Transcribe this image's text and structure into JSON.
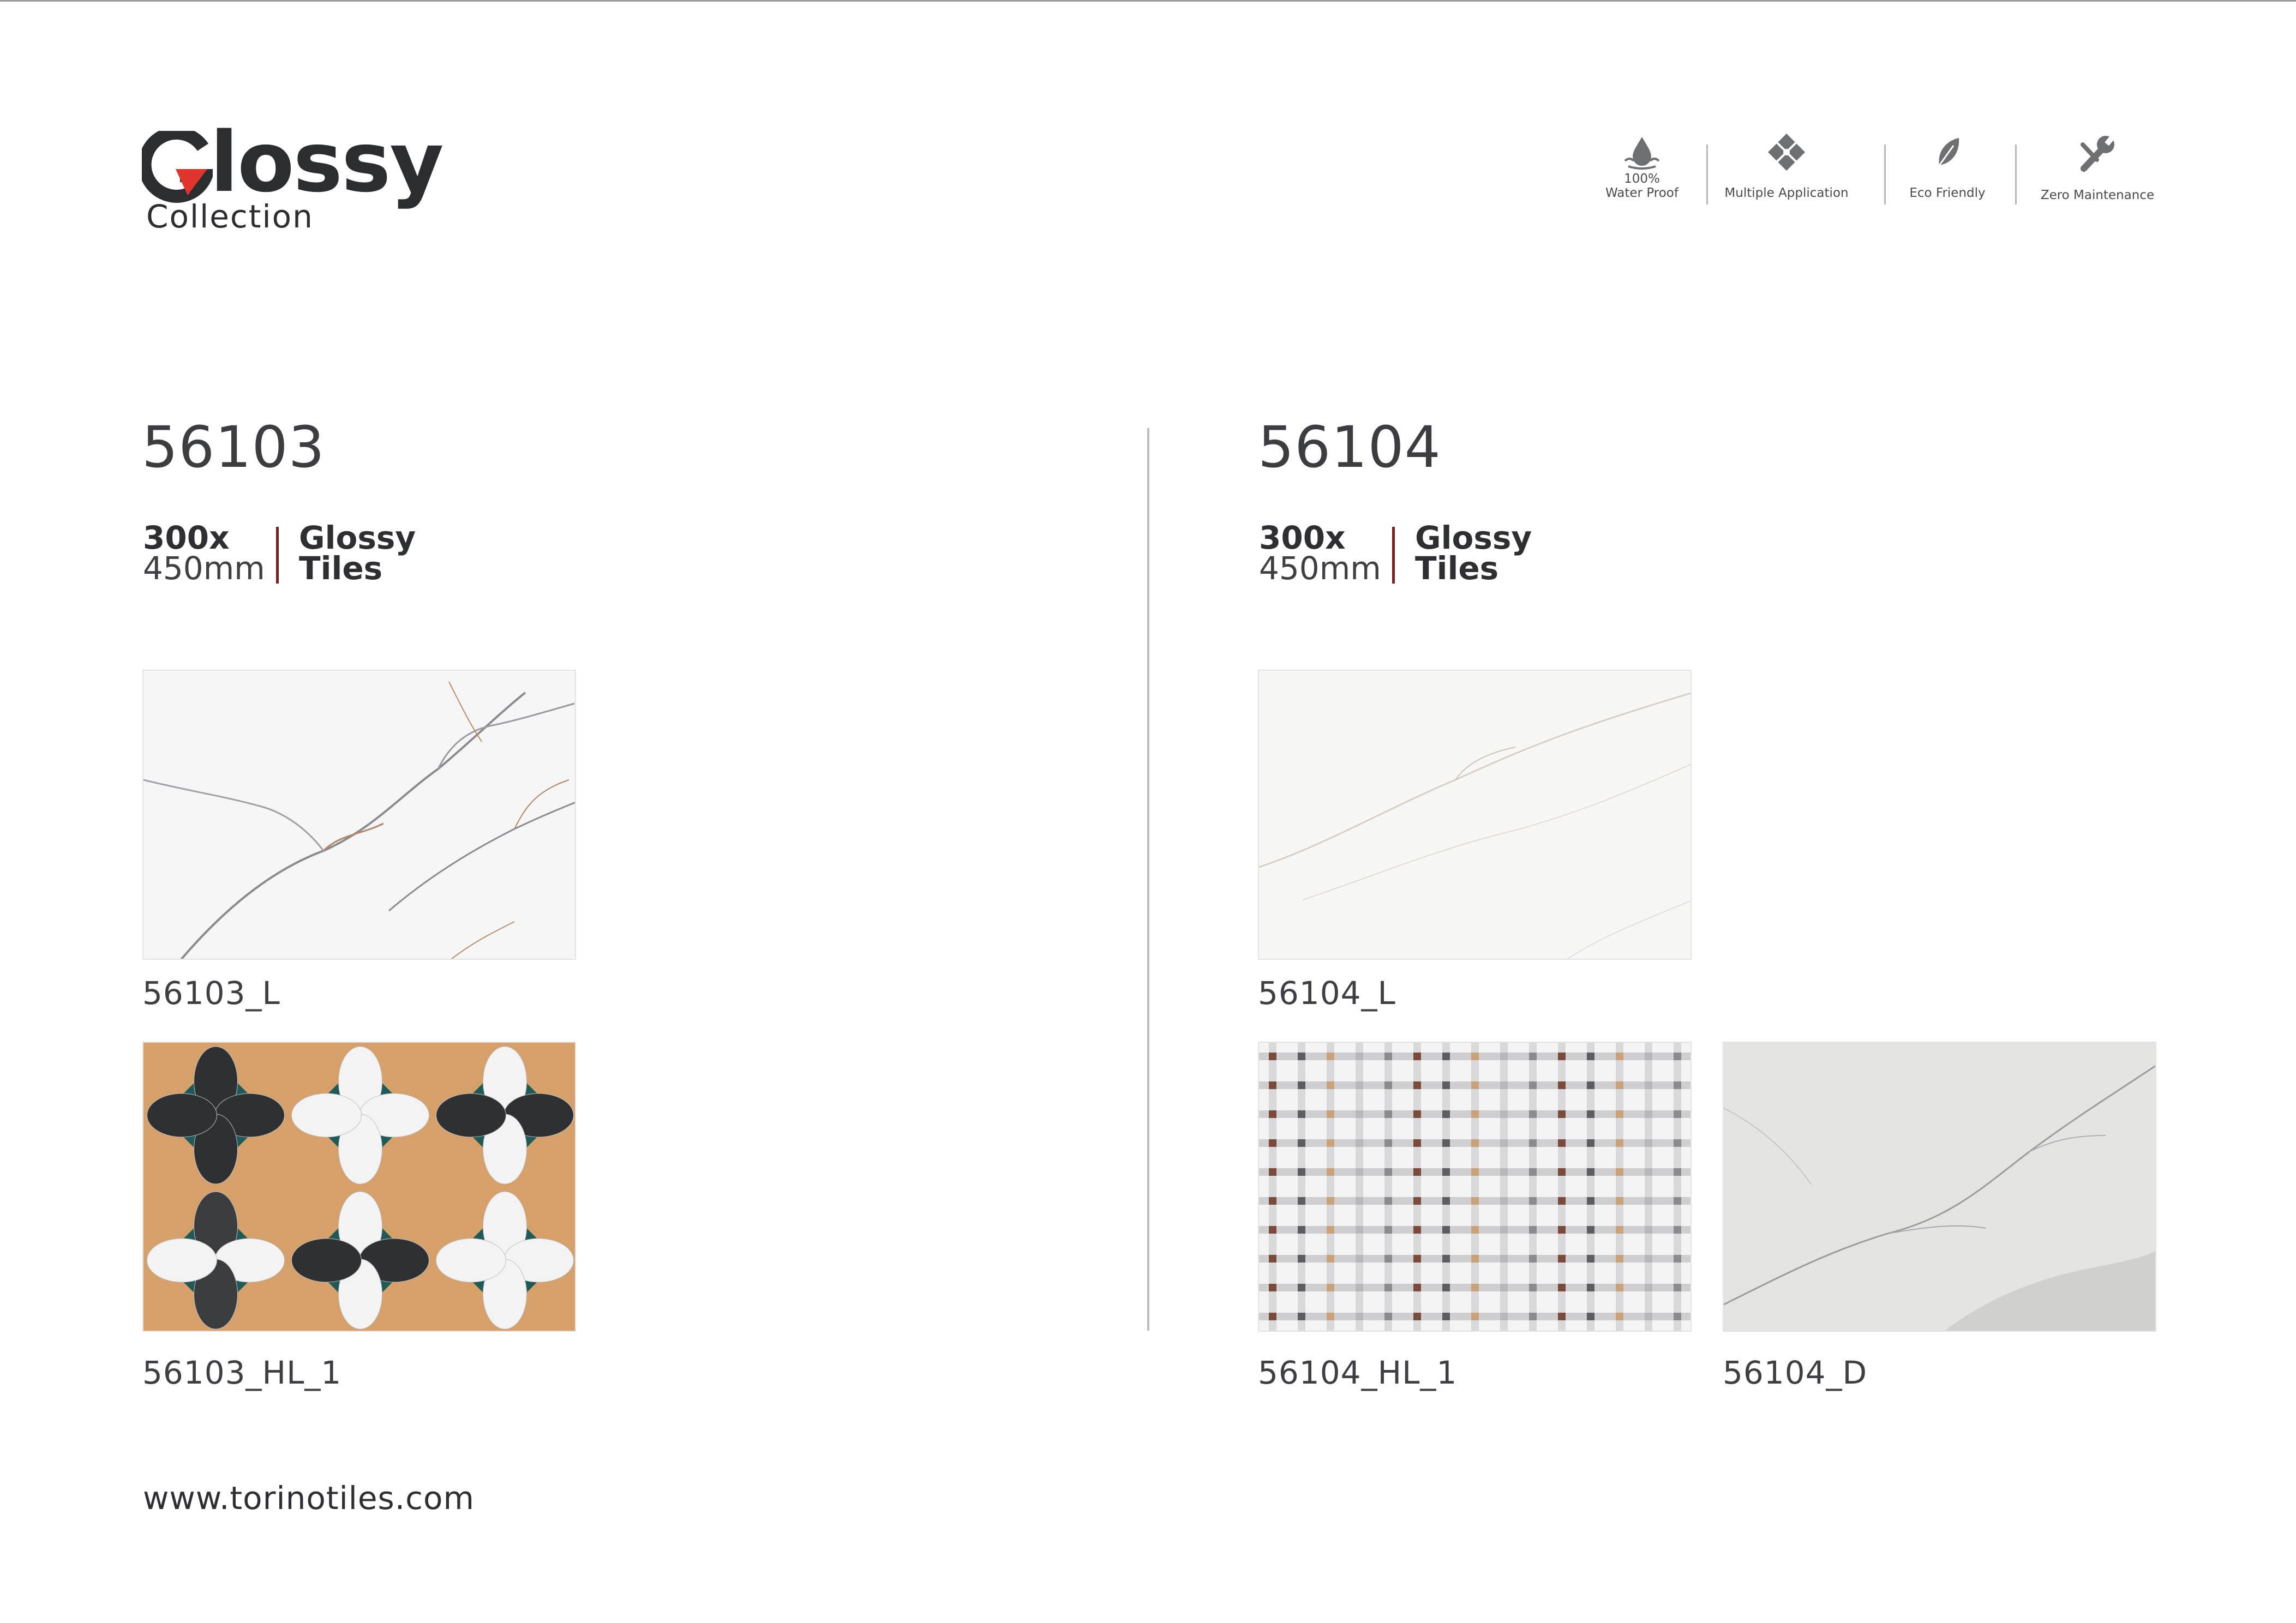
{
  "brand": {
    "logo_word": "lossy",
    "logo_sub": "Collection"
  },
  "features": [
    {
      "icon": "water-drop-icon",
      "line1": "100%",
      "line2": "Water Proof"
    },
    {
      "icon": "multiple-application-icon",
      "line1": "",
      "line2": "Multiple Application"
    },
    {
      "icon": "leaf-icon",
      "line1": "",
      "line2": "Eco Friendly"
    },
    {
      "icon": "wrench-icon",
      "line1": "",
      "line2": "Zero Maintenance"
    }
  ],
  "products": [
    {
      "code": "56103",
      "size_line1": "300x",
      "size_line2": "450mm",
      "type_line1": "Glossy",
      "type_line2": "Tiles",
      "tiles": [
        "56103_L",
        "56103_HL_1"
      ]
    },
    {
      "code": "56104",
      "size_line1": "300x",
      "size_line2": "450mm",
      "type_line1": "Glossy",
      "type_line2": "Tiles",
      "tiles": [
        "56104_L",
        "56104_HL_1",
        "56104_D"
      ]
    }
  ],
  "colors": {
    "accent_red": "#e0342c",
    "divider_red": "#7c1f22",
    "text_dark": "#2e2f32",
    "teal": "#1f5a58",
    "copper": "#d6a06a"
  },
  "footer": {
    "website": "www.torinotiles.com"
  }
}
